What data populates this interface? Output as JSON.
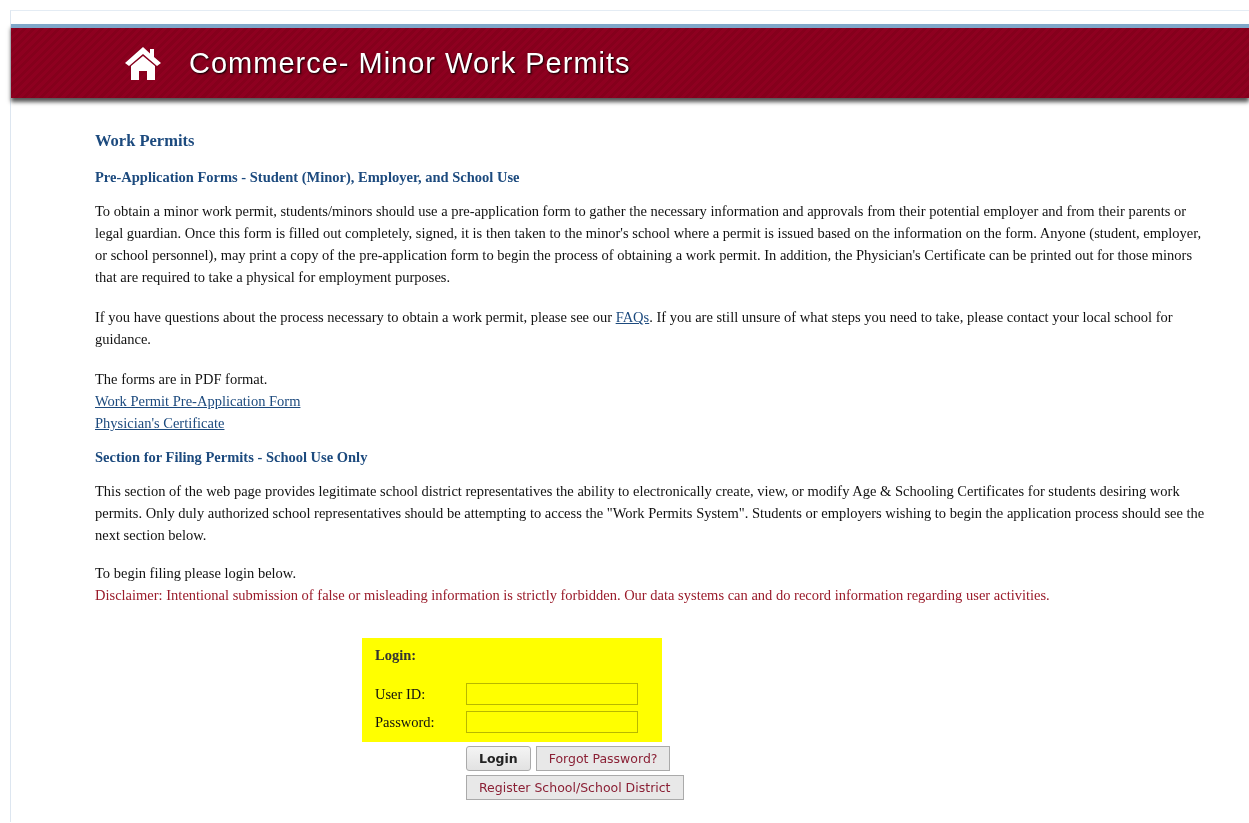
{
  "header": {
    "title": "Commerce- Minor Work Permits"
  },
  "heading": "Work Permits",
  "pre_application": {
    "heading": "Pre-Application Forms - Student (Minor), Employer, and School Use",
    "intro": "To obtain a minor work permit, students/minors should use a pre-application form to gather the necessary information and approvals from their potential employer and from their parents or legal guardian. Once this form is filled out completely, signed, it is then taken to the minor's school where a permit is issued based on the information on the form. Anyone (student, employer, or school personnel), may print a copy of the pre-application form to begin the process of obtaining a work permit. In addition, the Physician's Certificate can be printed out for those minors that are required to take a physical for employment purposes.",
    "questions": {
      "before": "If you have questions about the process necessary to obtain a work permit, please see our ",
      "link": "FAQs",
      "after": ". If you are still unsure of what steps you need to take, please contact your local school for guidance."
    },
    "format_note": "The forms are in PDF format.",
    "links": [
      "Work Permit Pre-Application Form",
      "Physician's Certificate"
    ]
  },
  "filing": {
    "heading": "Section for Filing Permits - School Use Only",
    "intro": "This section of the web page provides legitimate school district representatives the ability to electronically create, view, or modify Age & Schooling Certificates for students desiring work permits. Only duly authorized school representatives should be attempting to access the \"Work Permits System\". Students or employers wishing to begin the application process should see the next section below.",
    "login_prompt": "To begin filing please login below.",
    "disclaimer": "Disclaimer: Intentional submission of false or misleading information is strictly forbidden. Our data systems can and do record information regarding user activities."
  },
  "login": {
    "title": "Login:",
    "fields": [
      {
        "label": "User ID:"
      },
      {
        "label": "Password:"
      }
    ],
    "buttons": [
      {
        "label": "Login",
        "kind": "primary"
      },
      {
        "label": "Forgot Password?",
        "kind": "secondary"
      }
    ],
    "register_button": "Register School/School District"
  }
}
